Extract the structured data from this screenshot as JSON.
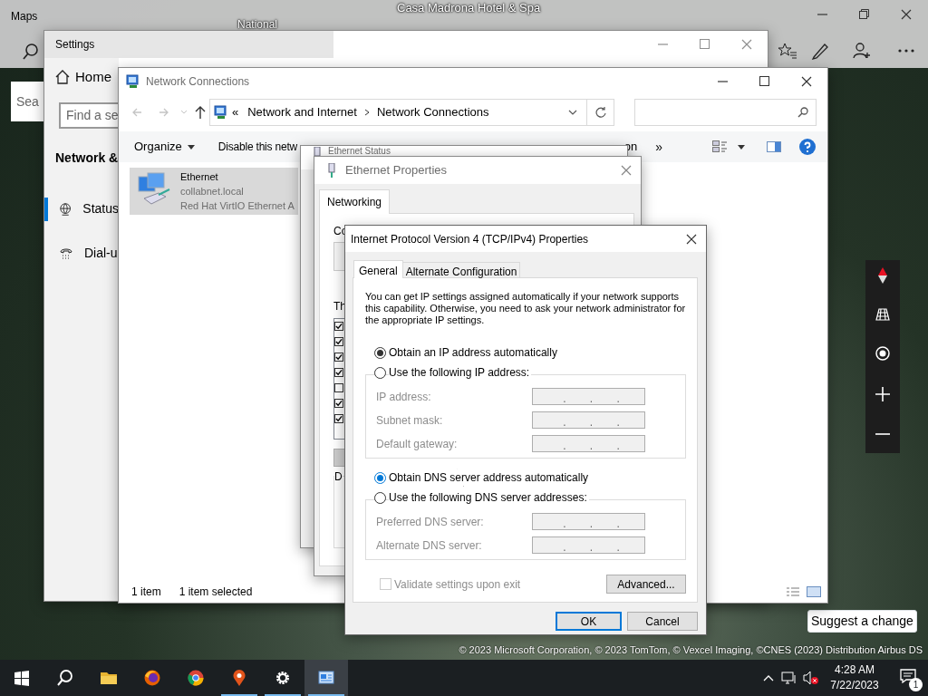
{
  "maps": {
    "title": "Maps",
    "map_labels": [
      "National",
      "Casa Madrona Hotel & Spa"
    ],
    "search_placeholder": "Sea",
    "suggest_button": "Suggest a change",
    "copyright": "© 2023 Microsoft Corporation, © 2023 TomTom, © Vexcel Imaging, ©CNES (2023) Distribution Airbus DS"
  },
  "settings": {
    "title": "Settings",
    "home": "Home",
    "search_placeholder": "Find a se",
    "section": "Network &",
    "nav": [
      {
        "label": "Status",
        "kind": "globe",
        "selected": true
      },
      {
        "label": "Dial-u",
        "kind": "phone",
        "selected": false
      }
    ]
  },
  "explorer": {
    "title": "Network Connections",
    "breadcrumb_overflow": "«",
    "breadcrumb": [
      "Network and Internet",
      "Network Connections"
    ],
    "toolbar": [
      "Organize",
      "Disable this netw"
    ],
    "toolbar_cut": "on",
    "more": "»",
    "item": {
      "name": "Ethernet",
      "domain": "collabnet.local",
      "adapter": "Red Hat VirtIO Ethernet A",
      "selected": true
    },
    "status": [
      "1 item",
      "1 item selected"
    ]
  },
  "ethernet_status": {
    "title": "Ethernet Status"
  },
  "ethernet_properties": {
    "title": "Ethernet Properties",
    "tab": "Networking",
    "connect_label": "Co",
    "list_label": "Th",
    "group_label": "D",
    "components": [
      {
        "checked": true
      },
      {
        "checked": true
      },
      {
        "checked": true
      },
      {
        "checked": true
      },
      {
        "checked": false
      },
      {
        "checked": true
      },
      {
        "checked": true
      }
    ]
  },
  "ipv4": {
    "title": "Internet Protocol Version 4 (TCP/IPv4) Properties",
    "tabs": [
      {
        "label": "General",
        "selected": true
      },
      {
        "label": "Alternate Configuration",
        "selected": false
      }
    ],
    "intro": "You can get IP settings assigned automatically if your network supports this capability. Otherwise, you need to ask your network administrator for the appropriate IP settings.",
    "ip_separator": ".",
    "sections": [
      {
        "options": [
          {
            "label": "Obtain an IP address automatically",
            "selected": true
          },
          {
            "label": "Use the following IP address:",
            "selected": false
          }
        ],
        "fields": [
          {
            "label": "IP address:",
            "disabled": true
          },
          {
            "label": "Subnet mask:",
            "disabled": true
          },
          {
            "label": "Default gateway:",
            "disabled": true
          }
        ]
      },
      {
        "options": [
          {
            "label": "Obtain DNS server address automatically",
            "selected": true
          },
          {
            "label": "Use the following DNS server addresses:",
            "selected": false
          }
        ],
        "fields": [
          {
            "label": "Preferred DNS server:",
            "disabled": true
          },
          {
            "label": "Alternate DNS server:",
            "disabled": true
          }
        ]
      }
    ],
    "validate": {
      "label": "Validate settings upon exit",
      "checked": false,
      "disabled": true
    },
    "advanced": "Advanced...",
    "ok": "OK",
    "cancel": "Cancel"
  },
  "taskbar": {
    "apps": [
      {
        "kind": "start",
        "running": false,
        "active": false
      },
      {
        "kind": "search",
        "running": false,
        "active": false
      },
      {
        "kind": "folder",
        "running": false,
        "active": false
      },
      {
        "kind": "firefox",
        "running": false,
        "active": false
      },
      {
        "kind": "chrome",
        "running": false,
        "active": false
      },
      {
        "kind": "maps",
        "running": true,
        "active": false
      },
      {
        "kind": "settings",
        "running": true,
        "active": false
      },
      {
        "kind": "network",
        "running": true,
        "active": true
      }
    ],
    "time": "4:28 AM",
    "date": "7/22/2023",
    "notifications": "1"
  }
}
